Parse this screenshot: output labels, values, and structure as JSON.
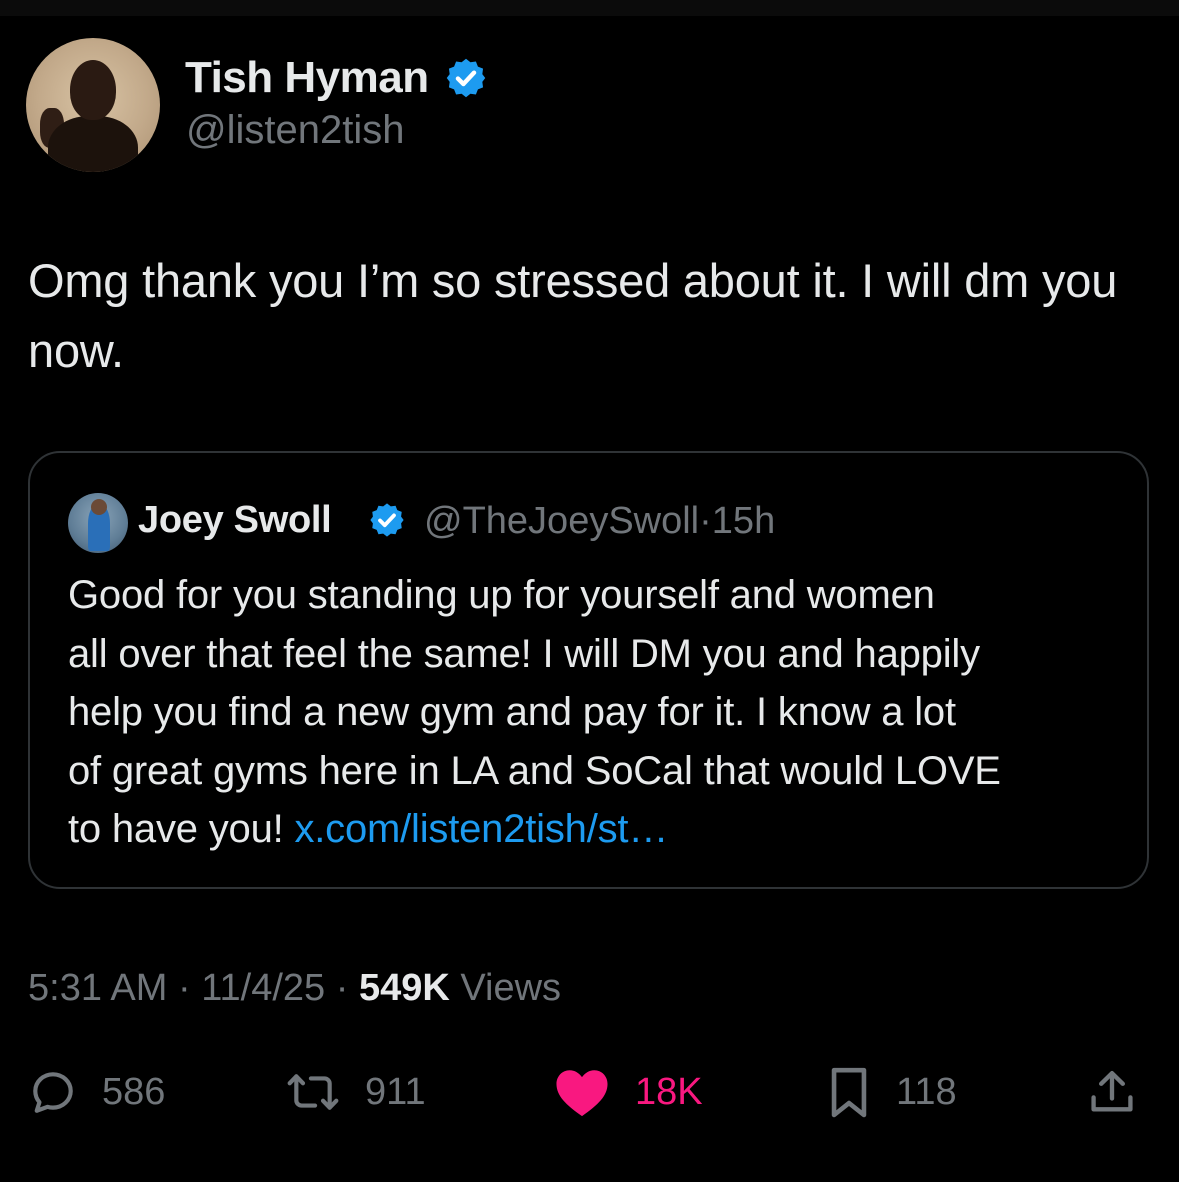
{
  "author": {
    "name": "Tish Hyman",
    "handle": "@listen2tish",
    "verified": true
  },
  "tweet": {
    "text": "Omg thank you I’m so stressed about it. I will dm you now."
  },
  "quote": {
    "name": "Joey Swoll",
    "handle": "@TheJoeySwoll",
    "separator": "·",
    "time": "15h",
    "verified": true,
    "text": "Good for you standing up for yourself and women\nall over that feel the same! I will DM you and happily\nhelp  you find a new gym and pay for it. I know a lot\nof great gyms here in LA and SoCal that would LOVE\nto have you! ",
    "link": "x.com/listen2tish/st…"
  },
  "meta": {
    "time": "5:31 AM",
    "sep1": "·",
    "date": "11/4/25",
    "sep2": "·",
    "views_count": "549K",
    "views_label": "Views"
  },
  "actions": {
    "replies": "586",
    "retweets": "911",
    "likes": "18K",
    "bookmarks": "118"
  },
  "colors": {
    "background": "#000000",
    "text": "#e7e9ea",
    "secondary": "#71767b",
    "link": "#1d9bf0",
    "verified": "#1d9bf0",
    "like": "#f91880",
    "border": "#2f3336"
  },
  "icons": {
    "verified": "verified-badge-icon",
    "reply": "reply-bubble-icon",
    "retweet": "retweet-arrows-icon",
    "like": "heart-filled-icon",
    "bookmark": "bookmark-icon",
    "share": "share-upload-icon"
  }
}
